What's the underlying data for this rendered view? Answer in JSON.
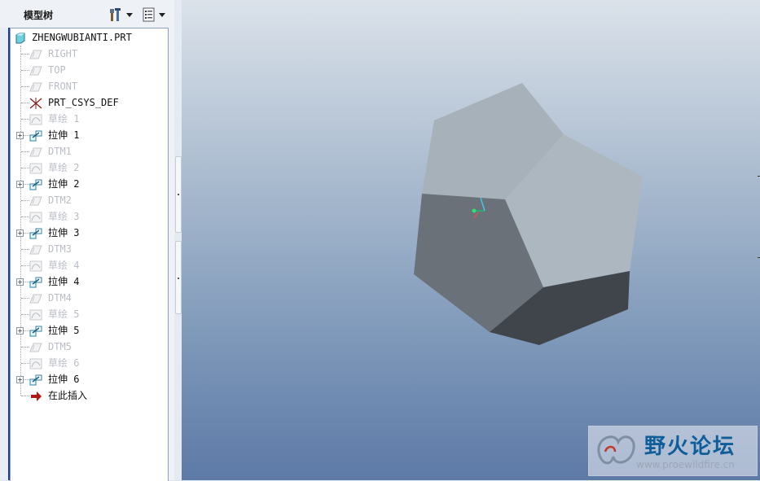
{
  "panel": {
    "title": "模型树",
    "settings_icon": "tools-icon",
    "show_icon": "list-icon"
  },
  "tree": [
    {
      "label": "ZHENGWUBIANTI.PRT",
      "icon": "part-icon",
      "state": "active",
      "expandable": false
    },
    {
      "label": "RIGHT",
      "icon": "datum-plane-icon",
      "state": "dim",
      "expandable": false
    },
    {
      "label": "TOP",
      "icon": "datum-plane-icon",
      "state": "dim",
      "expandable": false
    },
    {
      "label": "FRONT",
      "icon": "datum-plane-icon",
      "state": "dim",
      "expandable": false
    },
    {
      "label": "PRT_CSYS_DEF",
      "icon": "csys-icon",
      "state": "active",
      "expandable": false
    },
    {
      "label": "草绘 1",
      "icon": "sketch-icon",
      "state": "dim",
      "expandable": false
    },
    {
      "label": "拉伸 1",
      "icon": "extrude-icon",
      "state": "active",
      "expandable": true
    },
    {
      "label": "DTM1",
      "icon": "datum-plane-icon",
      "state": "dim",
      "expandable": false
    },
    {
      "label": "草绘 2",
      "icon": "sketch-icon",
      "state": "dim",
      "expandable": false
    },
    {
      "label": "拉伸 2",
      "icon": "extrude-icon",
      "state": "active",
      "expandable": true
    },
    {
      "label": "DTM2",
      "icon": "datum-plane-icon",
      "state": "dim",
      "expandable": false
    },
    {
      "label": "草绘 3",
      "icon": "sketch-icon",
      "state": "dim",
      "expandable": false
    },
    {
      "label": "拉伸 3",
      "icon": "extrude-icon",
      "state": "active",
      "expandable": true
    },
    {
      "label": "DTM3",
      "icon": "datum-plane-icon",
      "state": "dim",
      "expandable": false
    },
    {
      "label": "草绘 4",
      "icon": "sketch-icon",
      "state": "dim",
      "expandable": false
    },
    {
      "label": "拉伸 4",
      "icon": "extrude-icon",
      "state": "active",
      "expandable": true
    },
    {
      "label": "DTM4",
      "icon": "datum-plane-icon",
      "state": "dim",
      "expandable": false
    },
    {
      "label": "草绘 5",
      "icon": "sketch-icon",
      "state": "dim",
      "expandable": false
    },
    {
      "label": "拉伸 5",
      "icon": "extrude-icon",
      "state": "active",
      "expandable": true
    },
    {
      "label": "DTM5",
      "icon": "datum-plane-icon",
      "state": "dim",
      "expandable": false
    },
    {
      "label": "草绘 6",
      "icon": "sketch-icon",
      "state": "dim",
      "expandable": false
    },
    {
      "label": "拉伸 6",
      "icon": "extrude-icon",
      "state": "active",
      "expandable": true
    },
    {
      "label": "在此插入",
      "icon": "insert-here-arrow-icon",
      "state": "active",
      "expandable": false
    }
  ],
  "watermark": {
    "title": "野火论坛",
    "url": "www.proewildfire.cn"
  }
}
